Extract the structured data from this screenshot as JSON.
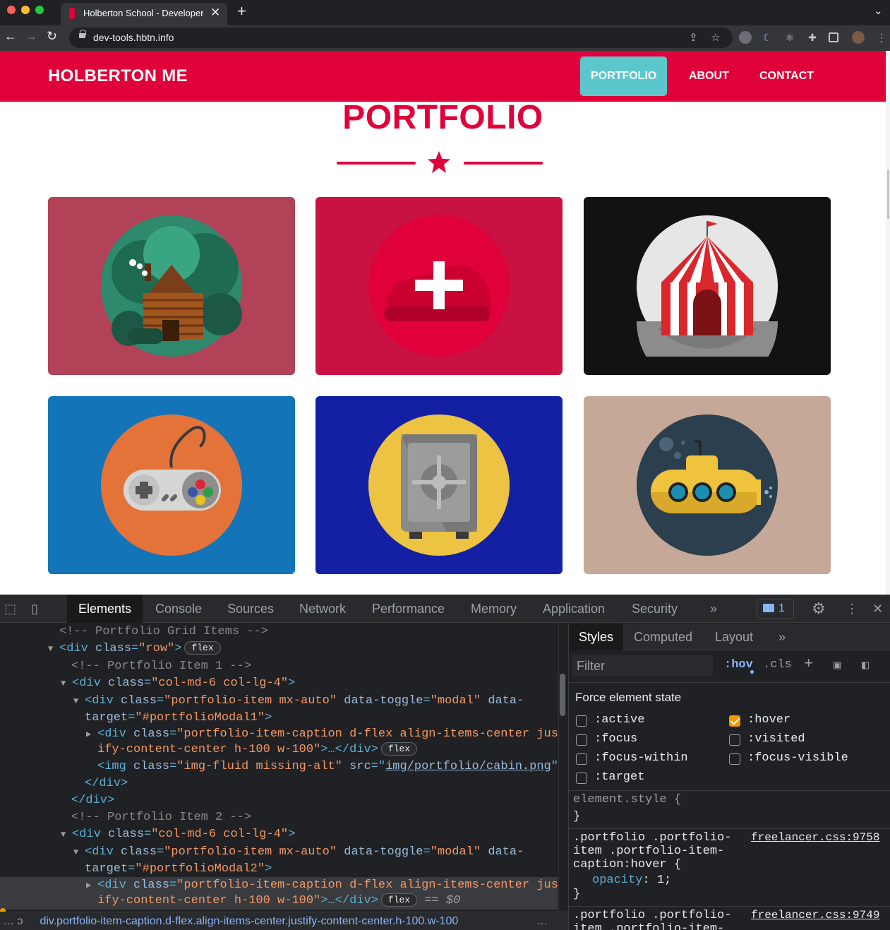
{
  "browser": {
    "tab_title": "Holberton School - Developer Tools",
    "url": "dev-tools.hbtn.info",
    "new_tab_symbol": "+",
    "close_symbol": "✕"
  },
  "site": {
    "brand": "HOLBERTON ME",
    "nav": [
      "PORTFOLIO",
      "ABOUT",
      "CONTACT"
    ],
    "active_nav": "PORTFOLIO",
    "heading": "PORTFOLIO",
    "colors": {
      "primary": "#e0003a",
      "nav_active": "#5bc7cd"
    },
    "portfolio_items": [
      {
        "image": "cabin",
        "background": "#b14258"
      },
      {
        "image": "cake",
        "background": "#ca1144",
        "hovered": true
      },
      {
        "image": "circus",
        "background": "#121212"
      },
      {
        "image": "game",
        "background": "#1474b8"
      },
      {
        "image": "safe",
        "background": "#1320a4"
      },
      {
        "image": "submarine",
        "background": "#c6a898"
      }
    ]
  },
  "devtools": {
    "tabs": [
      "Elements",
      "Console",
      "Sources",
      "Network",
      "Performance",
      "Memory",
      "Application",
      "Security"
    ],
    "selected_tab": "Elements",
    "more_tabs": "»",
    "issues_count": "1",
    "elements_lines": {
      "c1": "<!-- Portfolio Grid Items -->",
      "c2": "<!-- Portfolio Item 1 -->",
      "c3": "<!-- Portfolio Item 2 -->",
      "row_class": "\"row\"",
      "col_class": "\"col-md-6 col-lg-4\"",
      "item_class": "\"portfolio-item mx-auto\"",
      "toggle_val": "\"modal\"",
      "target1": "\"#portfolioModal1\"",
      "target2": "\"#portfolioModal2\"",
      "caption_class_1": "\"portfolio-item-caption d-flex align-items-center just",
      "caption_class_2": "ify-content-center h-100 w-100\"",
      "img_class": "\"img-fluid missing-alt\"",
      "img_src": "img/portfolio/cabin.png",
      "badge": "flex",
      "selected_marker": "== $0"
    },
    "breadcrumb": "div.portfolio-item-caption.d-flex.align-items-center.justify-content-center.h-100.w-100",
    "styles": {
      "tabs": [
        "Styles",
        "Computed",
        "Layout"
      ],
      "more": "»",
      "filter_placeholder": "Filter",
      "hov": ":hov",
      "cls": ".cls",
      "force_state_title": "Force element state",
      "states": [
        {
          "label": ":active",
          "checked": false
        },
        {
          "label": ":hover",
          "checked": true
        },
        {
          "label": ":focus",
          "checked": false
        },
        {
          "label": ":visited",
          "checked": false
        },
        {
          "label": ":focus-within",
          "checked": false
        },
        {
          "label": ":focus-visible",
          "checked": false
        },
        {
          "label": ":target",
          "checked": false
        }
      ],
      "element_style": "element.style {",
      "close_brace": "}",
      "rule1_selector": [
        ".portfolio .portfolio-",
        "item .portfolio-item-",
        "caption:hover {"
      ],
      "rule1_source": "freelancer.css:9758",
      "rule1_prop": "opacity",
      "rule1_value": "1;",
      "rule2_selector": [
        ".portfolio .portfolio-",
        "item .portfolio-item-"
      ],
      "rule2_source": "freelancer.css:9749"
    }
  }
}
